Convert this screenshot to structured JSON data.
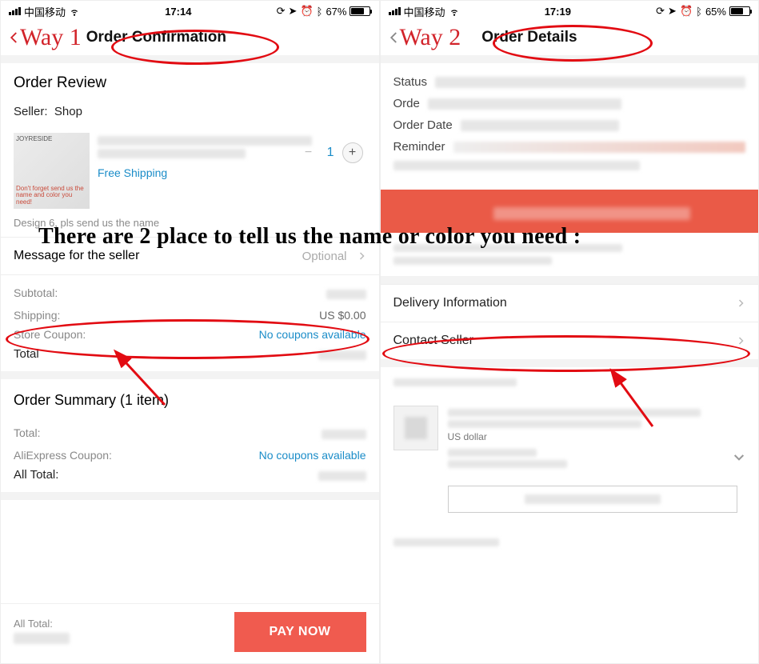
{
  "overlay": {
    "headline": "There are 2 place to tell us the name or color you need :"
  },
  "left": {
    "status": {
      "carrier": "中国移动",
      "time": "17:14",
      "battery_pct": "67%"
    },
    "way_label": "Way 1",
    "header_title": "Order Confirmation",
    "order_review_title": "Order Review",
    "seller_prefix": "Seller:",
    "seller_name": "Shop",
    "thumb_brand": "JOYRESIDE",
    "thumb_reminder": "Don't forget send us the name and color you need!",
    "free_shipping": "Free Shipping",
    "qty_value": "1",
    "variant_note": "Design 6, pls send us the name",
    "message_row_label": "Message for the seller",
    "message_row_hint": "Optional",
    "totals": {
      "subtotal_label": "Subtotal:",
      "shipping_label": "Shipping:",
      "shipping_value": "US $0.00",
      "coupon_label": "Store Coupon:",
      "coupon_value": "No coupons available",
      "total_label": "Total"
    },
    "summary_title": "Order Summary (1 item)",
    "summary": {
      "total_label": "Total:",
      "ae_coupon_label": "AliExpress Coupon:",
      "ae_coupon_value": "No coupons available",
      "all_total_label": "All Total:"
    },
    "footer": {
      "all_total_label": "All Total:",
      "pay_label": "PAY NOW"
    }
  },
  "right": {
    "status": {
      "carrier": "中国移动",
      "time": "17:19",
      "battery_pct": "65%"
    },
    "way_label": "Way 2",
    "header_title": "Order Details",
    "kv": {
      "status_label": "Status",
      "order_label": "Orde",
      "order_date_label": "Order Date",
      "reminder_label": "Reminder"
    },
    "rows": {
      "delivery": "Delivery Information",
      "contact": "Contact Seller"
    },
    "currency_line": "US dollar"
  }
}
